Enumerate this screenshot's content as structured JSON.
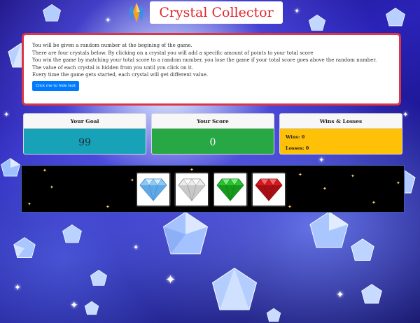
{
  "header": {
    "title": "Crystal Collector"
  },
  "instructions": {
    "lines": [
      "You will be given a random number at the begining of the game.",
      "There are four crystals below. By clicking on a crystal you will add a specific amount of points to your total score",
      "You win the game by matching your total score to a random number, you lose the game if your total score goes above the random number.",
      "The value of each crystal is hidden from you until you click on it.",
      "Every time the game gets started, each crystal will get different value."
    ],
    "hide_button": "Click me to hide text"
  },
  "goal": {
    "label": "Your Goal",
    "value": "99"
  },
  "score": {
    "label": "Your Score",
    "value": "0"
  },
  "wins_losses": {
    "label": "Wins & Losses",
    "wins_label": "Wins:",
    "wins": "0",
    "losses_label": "Losses:",
    "losses": "0"
  },
  "crystals": [
    {
      "name": "blue-crystal",
      "color": "#8ec9f5"
    },
    {
      "name": "clear-crystal",
      "color": "#e6e6e6"
    },
    {
      "name": "green-crystal",
      "color": "#27c42f"
    },
    {
      "name": "red-crystal",
      "color": "#d8181e"
    }
  ],
  "colors": {
    "title": "#e0262e",
    "instructions_border": "#dc3545",
    "goal_body": "#17a2b8",
    "score_body": "#28a745",
    "wins_body": "#ffc107",
    "button": "#007bff"
  }
}
